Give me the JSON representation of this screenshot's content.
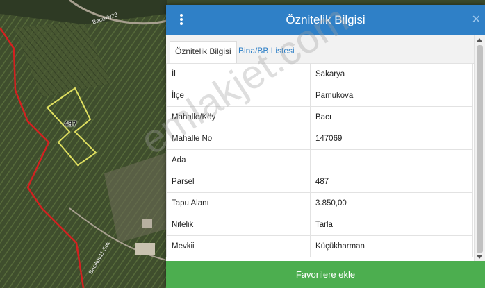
{
  "map": {
    "parcel_number": "487",
    "road_labels": [
      "Bacıköy23",
      "Bacıköy11 Sok."
    ]
  },
  "panel": {
    "title": "Öznitelik Bilgisi",
    "tabs": [
      {
        "label": "Öznitelik Bilgisi",
        "active": true
      },
      {
        "label": "Bina/BB Listesi",
        "active": false
      }
    ],
    "rows": [
      {
        "key": "İl",
        "value": "Sakarya"
      },
      {
        "key": "İlçe",
        "value": "Pamukova"
      },
      {
        "key": "Mahalle/Köy",
        "value": "Bacı"
      },
      {
        "key": "Mahalle No",
        "value": "147069"
      },
      {
        "key": "Ada",
        "value": ""
      },
      {
        "key": "Parsel",
        "value": "487"
      },
      {
        "key": "Tapu Alanı",
        "value": "3.850,00"
      },
      {
        "key": "Nitelik",
        "value": "Tarla"
      },
      {
        "key": "Mevkii",
        "value": "Küçükharman"
      }
    ],
    "favorite_button": "Favorilere ekle"
  },
  "watermark": "emlakjet.com",
  "colors": {
    "header": "#2f80c7",
    "favorite": "#4cae4f",
    "boundary": "#d42020",
    "parcel_outline": "#e0e060"
  }
}
